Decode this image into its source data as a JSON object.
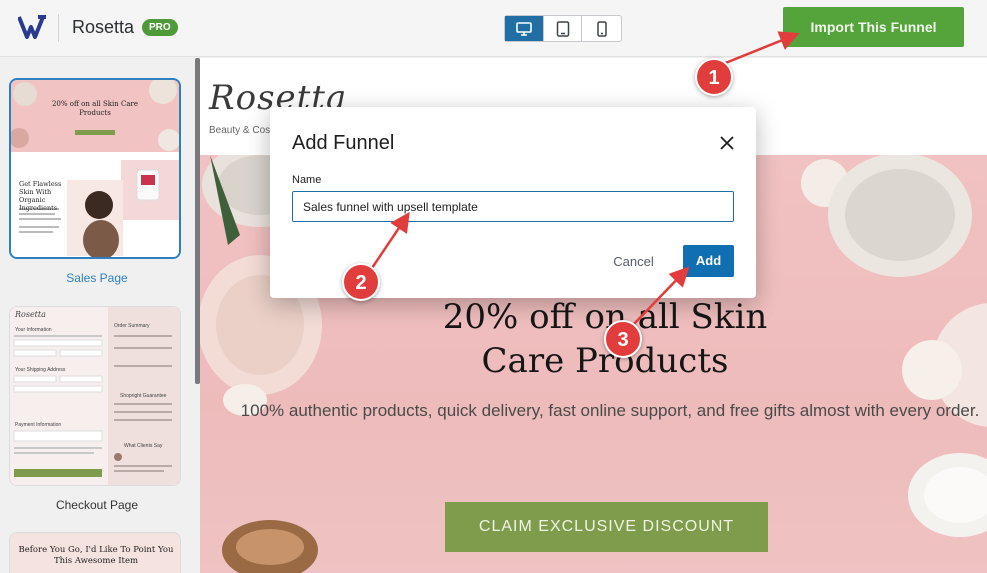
{
  "app": {
    "title": "Rosetta",
    "badge": "PRO",
    "accent": "#1f6fa5",
    "brand_green": "#55a43b"
  },
  "toolbar": {
    "devices": [
      {
        "icon": "desktop-icon",
        "active": true
      },
      {
        "icon": "tablet-icon",
        "active": false
      },
      {
        "icon": "mobile-icon",
        "active": false
      }
    ],
    "import_label": "Import This Funnel"
  },
  "sidebar": {
    "pages": [
      {
        "label": "Sales Page",
        "selected": true
      },
      {
        "label": "Checkout Page",
        "selected": false
      },
      {
        "label": "",
        "selected": false
      }
    ],
    "thumb_sales": {
      "headline": "20% off on all Skin Care Products",
      "section": "Get Flawless Skin With Organic Ingredients"
    },
    "thumb_checkout": {
      "brand": "Rosetta",
      "billing": "Your Information",
      "shipping": "Your Shipping Address",
      "payment": "Payment Information",
      "summary": "Order Summary",
      "guarantee": "Shopright Guarantee",
      "reviews": "What Clients Say"
    },
    "thumb_upsell": {
      "headline": "Before You Go, I'd Like To Point You This Awesome Item"
    }
  },
  "preview": {
    "brand": "Rosetta",
    "brand_tagline": "Beauty & Cosmetics",
    "hero_title_line1": "20% off on all Skin",
    "hero_title_line2": "Care Products",
    "hero_subtitle": "100% authentic products, quick delivery, fast online support, and free gifts almost with every order.",
    "cta": "CLAIM EXCLUSIVE DISCOUNT"
  },
  "modal": {
    "title": "Add Funnel",
    "field_label": "Name",
    "input_value": "Sales funnel with upsell template",
    "cancel_label": "Cancel",
    "add_label": "Add"
  },
  "annotations": [
    "1",
    "2",
    "3"
  ]
}
